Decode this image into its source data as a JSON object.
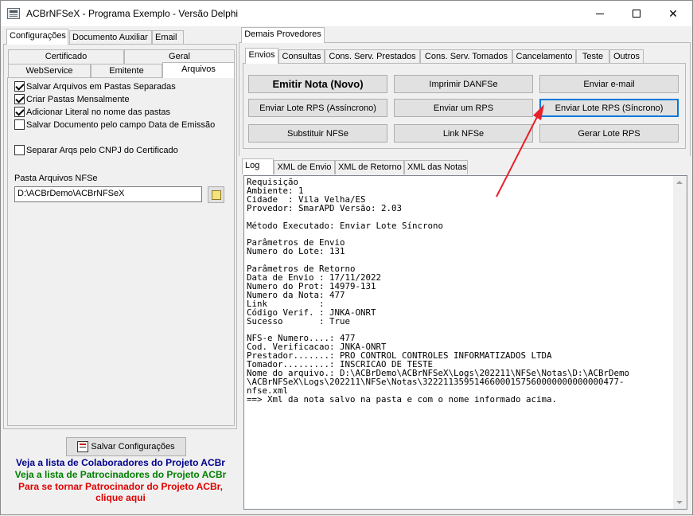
{
  "window": {
    "title": "ACBrNFSeX - Programa Exemplo - Versão Delphi"
  },
  "left": {
    "main_tabs": [
      "Configurações",
      "Documento Auxiliar",
      "Email"
    ],
    "sub_tabs_row1": [
      "Certificado",
      "Geral"
    ],
    "sub_tabs_row2": [
      "WebService",
      "Emitente",
      "Arquivos"
    ],
    "checkboxes": [
      {
        "label": "Salvar Arquivos em Pastas Separadas",
        "checked": true
      },
      {
        "label": "Criar Pastas Mensalmente",
        "checked": true
      },
      {
        "label": "Adicionar Literal no nome das pastas",
        "checked": true
      },
      {
        "label": "Salvar Documento pelo campo Data de Emissão",
        "checked": false
      },
      {
        "label": "Separar Arqs pelo CNPJ do Certificado",
        "checked": false
      }
    ],
    "pasta_label": "Pasta Arquivos NFSe",
    "pasta_value": "D:\\ACBrDemo\\ACBrNFSeX",
    "save_button": "Salvar Configurações",
    "link_colaboradores": "Veja a lista de Colaboradores do Projeto ACBr",
    "link_patrocinadores": "Veja a lista de Patrocinadores do Projeto ACBr",
    "link_tornar_line1": "Para se tornar Patrocinador do Projeto ACBr,",
    "link_tornar_line2": "clique aqui"
  },
  "right": {
    "outer_tab": "Demais Provedores",
    "tabs": [
      "Envios",
      "Consultas",
      "Cons. Serv. Prestados",
      "Cons. Serv. Tomados",
      "Cancelamento",
      "Teste",
      "Outros"
    ],
    "buttons": {
      "emitir_nota": "Emitir Nota (Novo)",
      "imprimir_danfse": "Imprimir DANFSe",
      "enviar_email": "Enviar e-mail",
      "enviar_lote_assincrono": "Enviar Lote RPS (Assíncrono)",
      "enviar_um_rps": "Enviar um RPS",
      "enviar_lote_sincrono": "Enviar Lote RPS (Síncrono)",
      "substituir_nfse": "Substituir NFSe",
      "link_nfse": "Link NFSe",
      "gerar_lote_rps": "Gerar Lote RPS"
    },
    "log_tabs": [
      "Log",
      "XML de Envio",
      "XML de Retorno",
      "XML das Notas"
    ],
    "log_text": "Requisição\nAmbiente: 1\nCidade  : Vila Velha/ES\nProvedor: SmarAPD Versão: 2.03\n\nMétodo Executado: Enviar Lote Síncrono\n\nParâmetros de Envio\nNumero do Lote: 131\n\nParâmetros de Retorno\nData de Envio : 17/11/2022\nNumero do Prot: 14979-131\nNumero da Nota: 477\nLink          :\nCódigo Verif. : JNKA-ONRT\nSucesso       : True\n\nNFS-e Numero....: 477\nCod. Verificacao: JNKA-ONRT\nPrestador.......: PRO CONTROL CONTROLES INFORMATIZADOS LTDA\nTomador.........: INSCRICAO DE TESTE\nNome do arquivo.: D:\\ACBrDemo\\ACBrNFSeX\\Logs\\202211\\NFSe\\Notas\\D:\\ACBrDemo\n\\ACBrNFSeX\\Logs\\202211\\NFSe\\Notas\\32221135951466000157560000000000000477-\nnfse.xml\n==> Xml da nota salvo na pasta e com o nome informado acima."
  },
  "colors": {
    "accent": "#0078d7",
    "arrow": "#e8202a",
    "blue_link": "#00008b",
    "green_link": "#008000",
    "red_link": "#e00000"
  }
}
